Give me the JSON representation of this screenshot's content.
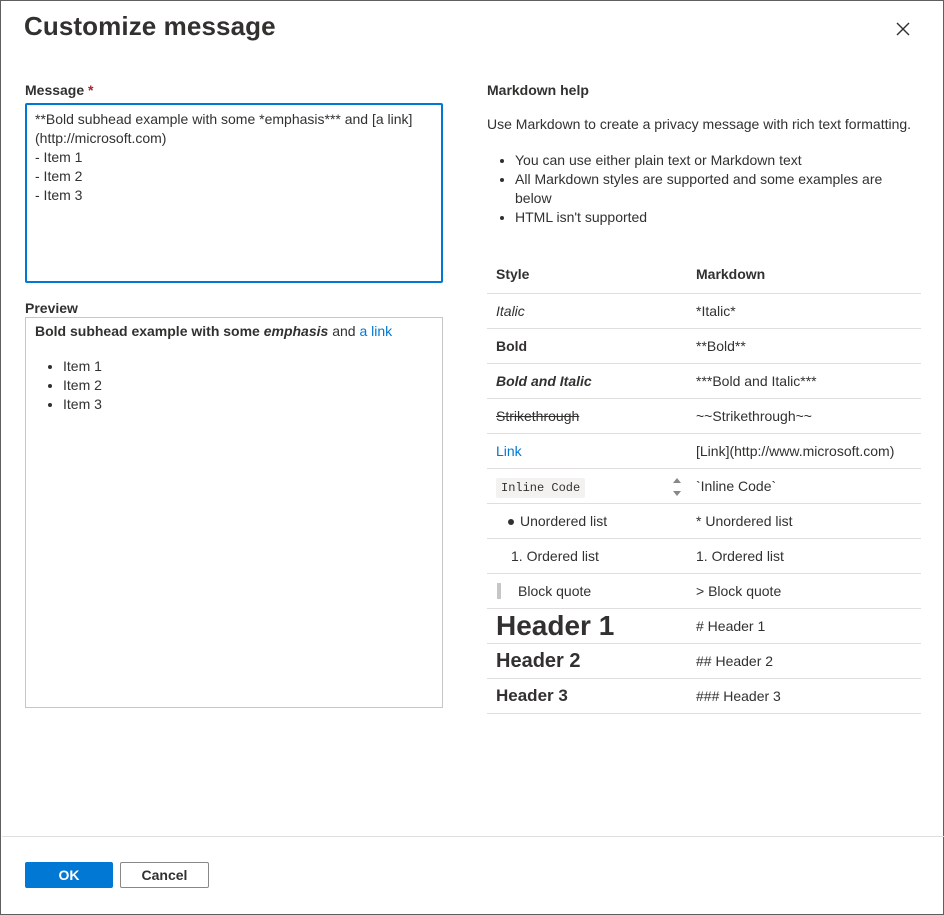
{
  "dialog": {
    "title": "Customize message",
    "close_icon": "close-icon"
  },
  "message": {
    "label": "Message",
    "required_marker": "*",
    "value": "**Bold subhead example with some *emphasis*** and [a link](http://microsoft.com)\n- Item 1\n- Item 2\n- Item 3"
  },
  "preview": {
    "label": "Preview",
    "bold_prefix": "Bold subhead example with some ",
    "emphasis": "emphasis",
    "connector": " and ",
    "link_text": "a link",
    "items": [
      "Item 1",
      "Item 2",
      "Item 3"
    ]
  },
  "help": {
    "title": "Markdown help",
    "intro": "Use Markdown to create a privacy message with rich text formatting.",
    "bullets": [
      "You can use either plain text or Markdown text",
      "All Markdown styles are supported and some examples are below",
      "HTML isn't supported"
    ]
  },
  "table": {
    "headers": [
      "Style",
      "Markdown"
    ],
    "rows": [
      {
        "style": "Italic",
        "markdown": "*Italic*"
      },
      {
        "style": "Bold",
        "markdown": "**Bold**"
      },
      {
        "style": "Bold and Italic",
        "markdown": "***Bold and Italic***"
      },
      {
        "style": "Strikethrough",
        "markdown": "~~Strikethrough~~"
      },
      {
        "style": "Link",
        "markdown": "[Link](http://www.microsoft.com)"
      },
      {
        "style": "Inline Code",
        "markdown": "`Inline Code`"
      },
      {
        "style": "Unordered list",
        "markdown": "* Unordered list"
      },
      {
        "style": "1. Ordered list",
        "markdown": "1. Ordered list"
      },
      {
        "style": "Block quote",
        "markdown": "> Block quote"
      },
      {
        "style": "Header 1",
        "markdown": "# Header 1"
      },
      {
        "style": "Header 2",
        "markdown": "## Header 2"
      },
      {
        "style": "Header 3",
        "markdown": "### Header 3"
      }
    ]
  },
  "footer": {
    "ok_label": "OK",
    "cancel_label": "Cancel"
  },
  "colors": {
    "accent": "#0078d4",
    "required": "#a4262c",
    "text": "#323130",
    "border": "#c8c6c4"
  }
}
